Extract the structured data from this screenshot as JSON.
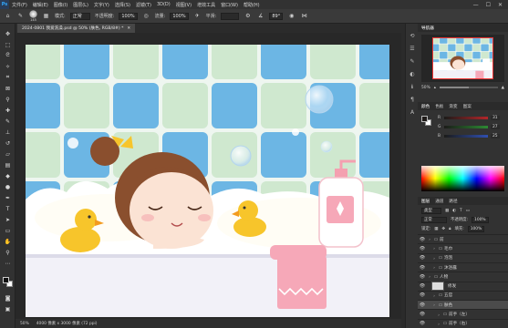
{
  "app": {
    "logo": "Ps"
  },
  "menu": [
    "文件(F)",
    "编辑(E)",
    "图像(I)",
    "图层(L)",
    "文字(Y)",
    "选择(S)",
    "滤镜(T)",
    "3D(D)",
    "视图(V)",
    "增效工具",
    "窗口(W)",
    "帮助(H)"
  ],
  "window_controls": [
    "—",
    "☐",
    "✕"
  ],
  "options": {
    "brush_size": "145",
    "mode_label": "模式:",
    "mode_value": "正常",
    "opacity_label": "不透明度:",
    "opacity_value": "100%",
    "flow_label": "流量:",
    "flow_value": "100%",
    "smooth_label": "平滑:",
    "angle_value": "89°"
  },
  "document_tab": {
    "title": "2024-0801 我爱洗澡.psd @ 50% (肤色, RGB/8#) *",
    "close": "✕"
  },
  "status": {
    "zoom": "50%",
    "size": "4000 像素 x 3000 像素 (72 ppi)"
  },
  "navigator": {
    "tabs": [
      "导航器"
    ],
    "zoom": "50%",
    "zoom_fraction": 0.5
  },
  "color_panel": {
    "tabs": [
      "颜色",
      "色板",
      "渐变",
      "图案"
    ],
    "sliders": [
      {
        "label": "R",
        "value": "31",
        "track": "#b3262a"
      },
      {
        "label": "G",
        "value": "27",
        "track": "#2d8a33"
      },
      {
        "label": "B",
        "value": "25",
        "track": "#2f4fb0"
      }
    ],
    "foreground": "#1f1b19"
  },
  "layers_panel": {
    "tabs": [
      "图层",
      "通道",
      "路径"
    ],
    "kind": "类型",
    "blend": "正常",
    "opacity_label": "不透明度:",
    "opacity": "100%",
    "lock_label": "锁定:",
    "fill_label": "填充:",
    "fill": "100%",
    "layers": [
      {
        "name": "前",
        "type": "group",
        "depth": 0,
        "selected": false
      },
      {
        "name": "毛巾",
        "type": "group",
        "depth": 1,
        "selected": false
      },
      {
        "name": "泡泡",
        "type": "group",
        "depth": 1,
        "selected": false
      },
      {
        "name": "沐浴露",
        "type": "group",
        "depth": 1,
        "selected": false
      },
      {
        "name": "人物",
        "type": "group",
        "depth": 0,
        "selected": false
      },
      {
        "name": "修发",
        "type": "layer",
        "depth": 1,
        "selected": false
      },
      {
        "name": "五官",
        "type": "group",
        "depth": 1,
        "selected": false
      },
      {
        "name": "肤色",
        "type": "group",
        "depth": 1,
        "selected": true
      },
      {
        "name": "前手（左）",
        "type": "group",
        "depth": 2,
        "selected": false
      },
      {
        "name": "前手（右）",
        "type": "group",
        "depth": 2,
        "selected": false
      }
    ]
  },
  "colors": {
    "tile_blue": "#6cb6e4",
    "tile_green": "#cfe8cf",
    "grout": "#eef6f0",
    "foam": "#ffffff",
    "tub": "#f2f1f8",
    "towel": "#f6a8b8",
    "duck": "#f7c52b",
    "hair": "#8a4f2e",
    "skin": "#fbe3d4"
  }
}
